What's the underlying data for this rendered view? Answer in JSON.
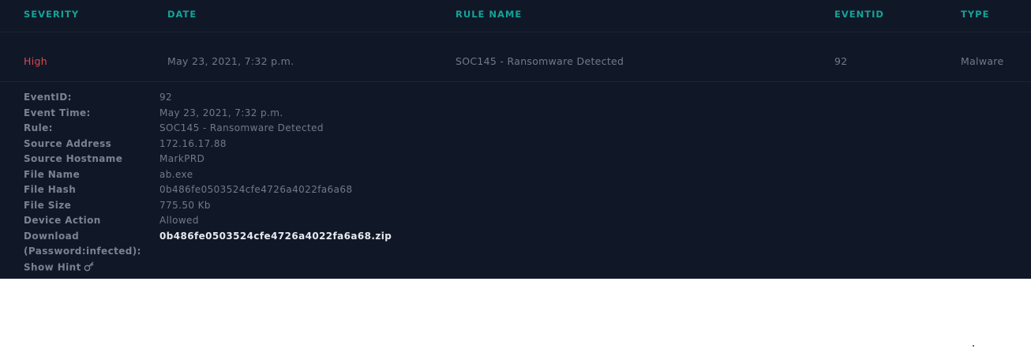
{
  "table": {
    "headers": {
      "severity": "SEVERITY",
      "date": "DATE",
      "rule_name": "RULE NAME",
      "eventid": "EVENTID",
      "type": "TYPE"
    },
    "row": {
      "severity": "High",
      "date": "May 23, 2021, 7:32 p.m.",
      "rule_name": "SOC145 - Ransomware Detected",
      "eventid": "92",
      "type": "Malware"
    }
  },
  "details": [
    {
      "label": "EventID:",
      "value": "92"
    },
    {
      "label": "Event Time:",
      "value": "May 23, 2021, 7:32 p.m."
    },
    {
      "label": "Rule:",
      "value": "SOC145 - Ransomware Detected"
    },
    {
      "label": "Source Address",
      "value": "172.16.17.88"
    },
    {
      "label": "Source Hostname",
      "value": "MarkPRD"
    },
    {
      "label": "File Name",
      "value": "ab.exe"
    },
    {
      "label": "File Hash",
      "value": "0b486fe0503524cfe4726a4022fa6a68"
    },
    {
      "label": "File Size",
      "value": "775.50 Kb"
    },
    {
      "label": "Device Action",
      "value": "Allowed"
    },
    {
      "label": "Download",
      "value": "0b486fe0503524cfe4726a4022fa6a68.zip"
    },
    {
      "label": "(Password:infected):",
      "value": ""
    }
  ],
  "hint": {
    "label": "Show Hint",
    "icon": "key-icon"
  },
  "colors": {
    "panel_bg": "#101828",
    "header_accent": "#14a397",
    "severity_high": "#e0474c",
    "link": "#e6e9ee"
  }
}
